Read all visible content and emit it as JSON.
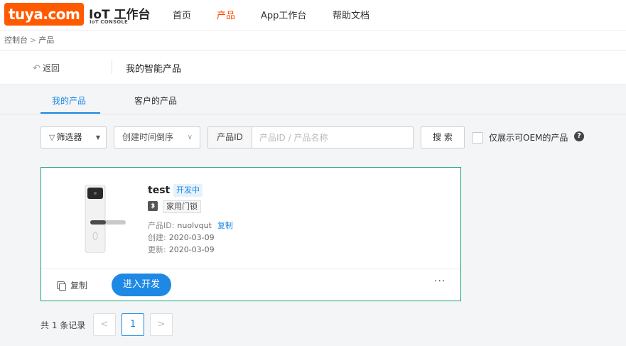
{
  "topnav": {
    "logo_text": "tuya.com",
    "console_title": "IoT 工作台",
    "console_subtitle": "IoT CONSOLE",
    "items": [
      {
        "label": "首页"
      },
      {
        "label": "产品"
      },
      {
        "label": "App工作台"
      },
      {
        "label": "帮助文档"
      }
    ],
    "active_item": "产品",
    "active_color": "#ff4800",
    "brand_color": "#ff5a00"
  },
  "breadcrumb": {
    "items": [
      "控制台",
      "产品"
    ],
    "separator": ">"
  },
  "backbar": {
    "back_label": "返回",
    "page_title": "我的智能产品"
  },
  "tabs": {
    "items": [
      {
        "label": "我的产品"
      },
      {
        "label": "客户的产品"
      }
    ],
    "active_color": "#1e88e5"
  },
  "filters": {
    "filter_label": "筛选器",
    "sort_value": "创建时间倒序",
    "search_prefix": "产品ID",
    "search_placeholder": "产品ID / 产品名称",
    "search_value": "",
    "search_button": "搜 索",
    "oem_checked": false,
    "oem_label": "仅展示可OEM的产品"
  },
  "products": [
    {
      "name": "test",
      "status": "开发中",
      "category": "家用门锁",
      "id_label": "产品ID:",
      "id_value": "nuolvqut",
      "copy_label": "复制",
      "created_label": "创建:",
      "created_value": "2020-03-09",
      "updated_label": "更新:",
      "updated_value": "2020-03-09",
      "card_copy_label": "复制",
      "enter_dev_label": "进入开发",
      "more_label": "···"
    }
  ],
  "pagination": {
    "total_text": "共 1 条记录",
    "current_page": "1",
    "prev_label": "<",
    "next_label": ">"
  }
}
